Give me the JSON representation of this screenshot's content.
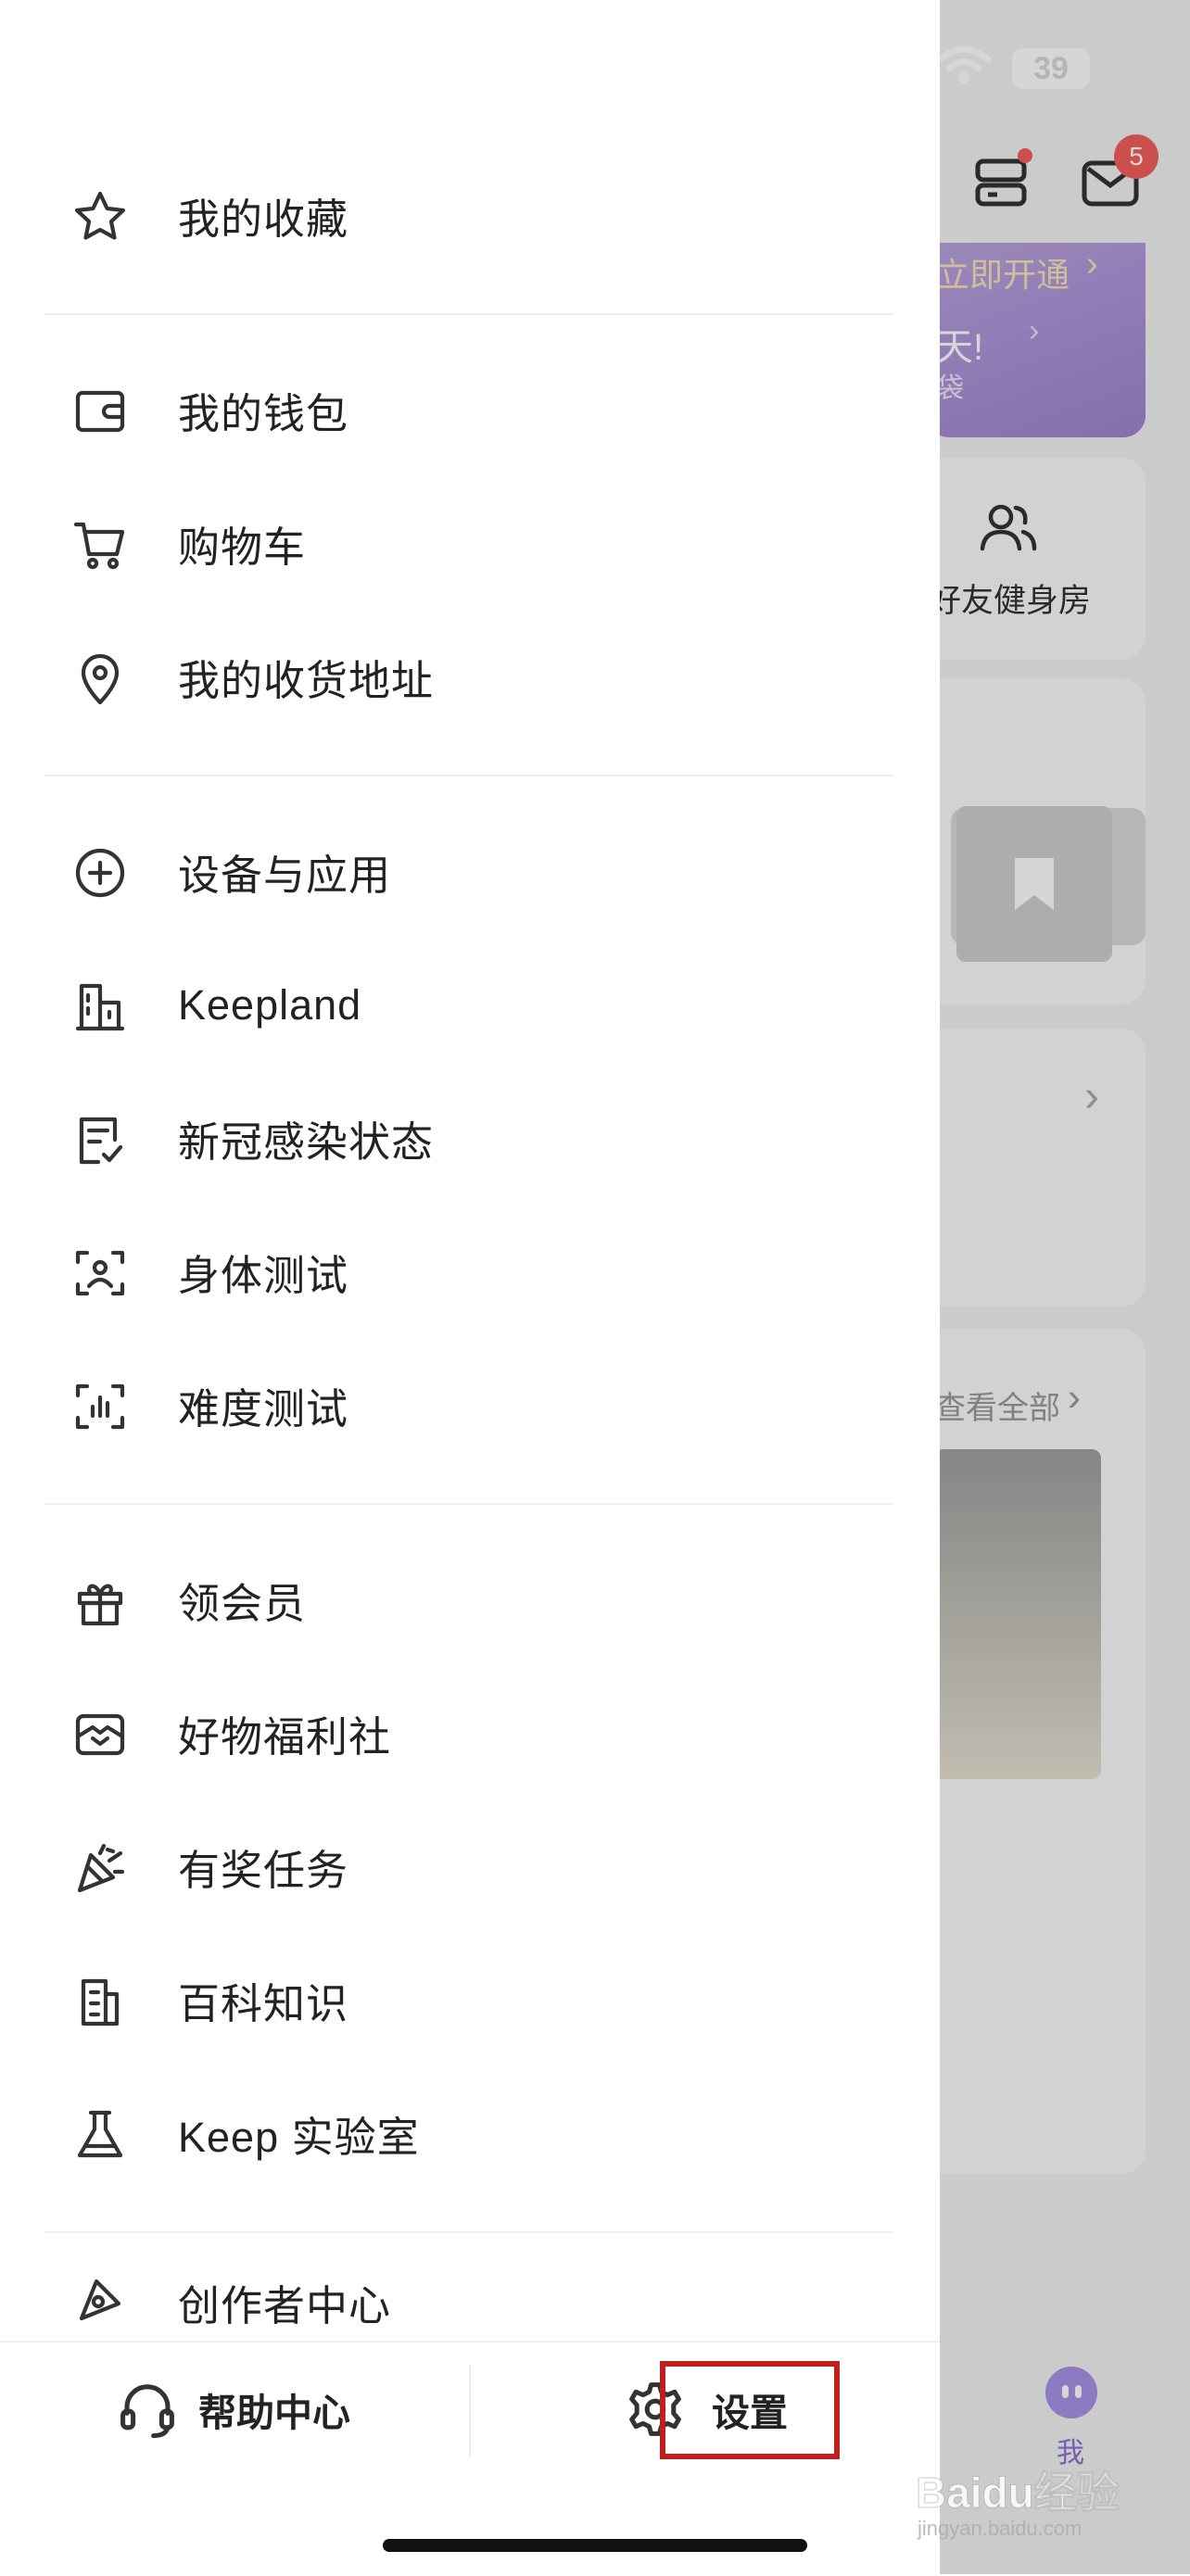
{
  "status_bar": {
    "battery": "39"
  },
  "background": {
    "badge_count": "5",
    "vip_cta": "立即开通",
    "vip_text": "天!",
    "vip_sub": "袋",
    "friends_gym": "好友健身房",
    "view_all": "查看全部",
    "tab_me": "我"
  },
  "drawer": {
    "items": [
      {
        "label": "我的收藏"
      },
      {
        "label": "我的钱包"
      },
      {
        "label": "购物车"
      },
      {
        "label": "我的收货地址"
      },
      {
        "label": "设备与应用"
      },
      {
        "label": "Keepland"
      },
      {
        "label": "新冠感染状态"
      },
      {
        "label": "身体测试"
      },
      {
        "label": "难度测试"
      },
      {
        "label": "领会员"
      },
      {
        "label": "好物福利社"
      },
      {
        "label": "有奖任务"
      },
      {
        "label": "百科知识"
      },
      {
        "label": "Keep 实验室"
      },
      {
        "label": "创作者中心"
      }
    ],
    "bottom": {
      "help_label": "帮助中心",
      "settings_label": "设置"
    }
  },
  "watermark": {
    "text": "Baidu经验",
    "sub": "jingyan.baidu.com"
  },
  "colors": {
    "accent_purple": "#8b6fd6",
    "highlight_red": "#c01f1f",
    "badge_red": "#f25f5c"
  }
}
